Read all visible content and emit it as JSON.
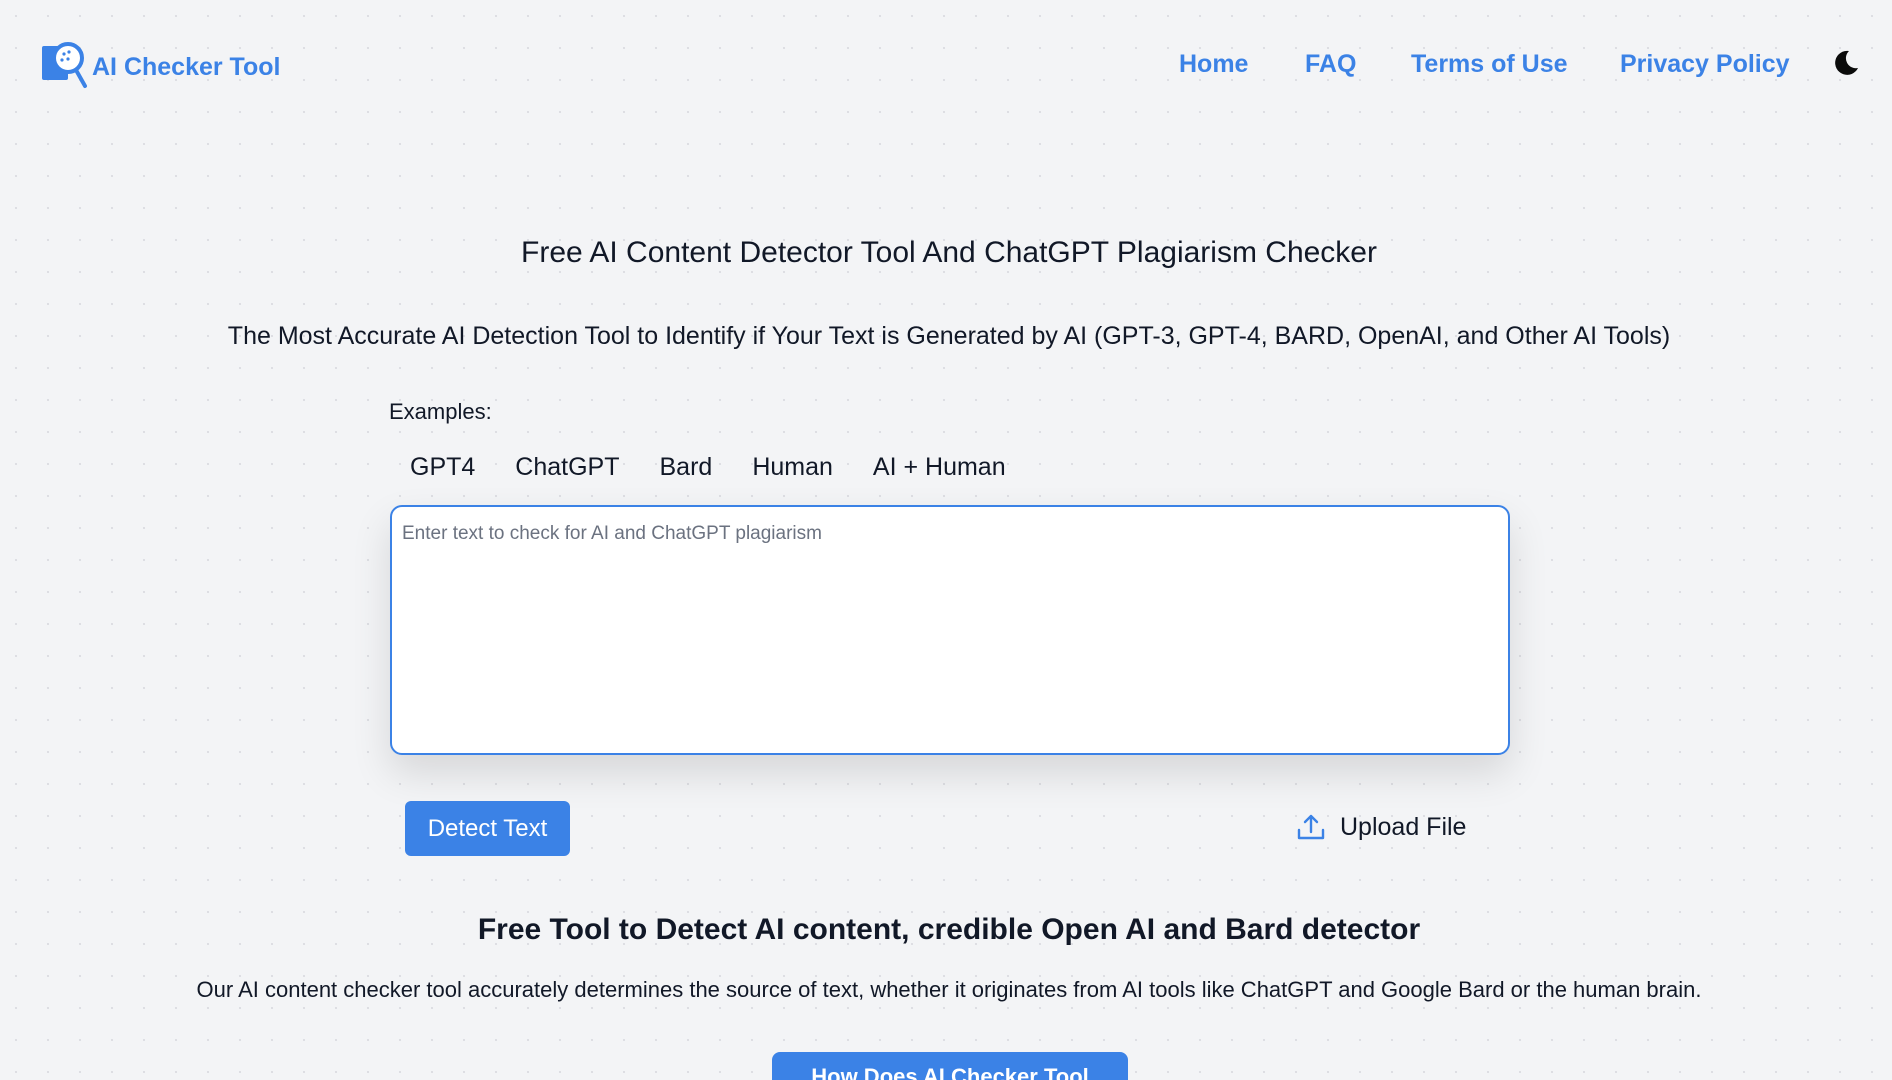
{
  "header": {
    "logo_text": "AI Checker Tool",
    "nav": {
      "home": "Home",
      "faq": "FAQ",
      "terms": "Terms of Use",
      "privacy": "Privacy Policy"
    },
    "theme_icon": "moon-icon"
  },
  "hero": {
    "title": "Free AI Content Detector Tool And ChatGPT Plagiarism Checker",
    "subtitle": "The Most Accurate AI Detection Tool to Identify if Your Text is Generated by AI (GPT-3, GPT-4, BARD, OpenAI, and Other AI Tools)"
  },
  "examples": {
    "label": "Examples:",
    "tabs": [
      "GPT4",
      "ChatGPT",
      "Bard",
      "Human",
      "AI + Human"
    ]
  },
  "input": {
    "value": "",
    "placeholder": "Enter text to check for AI and ChatGPT plagiarism"
  },
  "actions": {
    "detect_label": "Detect Text",
    "upload_label": "Upload File",
    "upload_icon": "upload-icon"
  },
  "section": {
    "title": "Free Tool to Detect AI content, credible Open AI and Bard detector",
    "description": "Our AI content checker tool accurately determines the source of text, whether it originates from AI tools like ChatGPT and Google Bard or the human brain.",
    "button_label": "How Does AI Checker Tool Work?"
  },
  "colors": {
    "accent": "#3b82e6",
    "background": "#f3f4f6",
    "text": "#111827"
  }
}
